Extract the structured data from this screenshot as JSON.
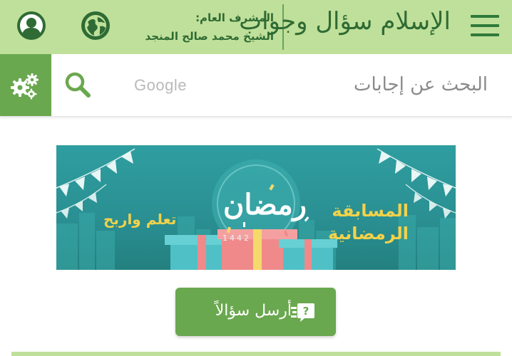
{
  "header": {
    "logo_text": "الإسلام سؤال وجواب",
    "supervisor_title": "المشرف العام:",
    "supervisor_name": "الشيخ محمد صالح المنجد",
    "icons": {
      "menu": "hamburger-menu-icon",
      "language": "globe-icon",
      "account": "user-icon"
    }
  },
  "search": {
    "placeholder": "البحث عن إجابات",
    "provider": "Google",
    "icons": {
      "search": "search-icon",
      "settings": "gears-icon"
    }
  },
  "banner": {
    "title_line1": "المسابقة",
    "title_line2": "الرمضانية",
    "slogan": "تعلم واربح",
    "ramadan": "رمضان",
    "year": "1442"
  },
  "ask_button": {
    "label": "أرسل سؤالاً",
    "icon": "question-chat-icon"
  },
  "colors": {
    "header_bg": "#bfe09a",
    "primary_green": "#6aa84f",
    "dark_green": "#2f6b34",
    "banner_teal": "#2a8f92",
    "banner_gold": "#f2d24a"
  }
}
